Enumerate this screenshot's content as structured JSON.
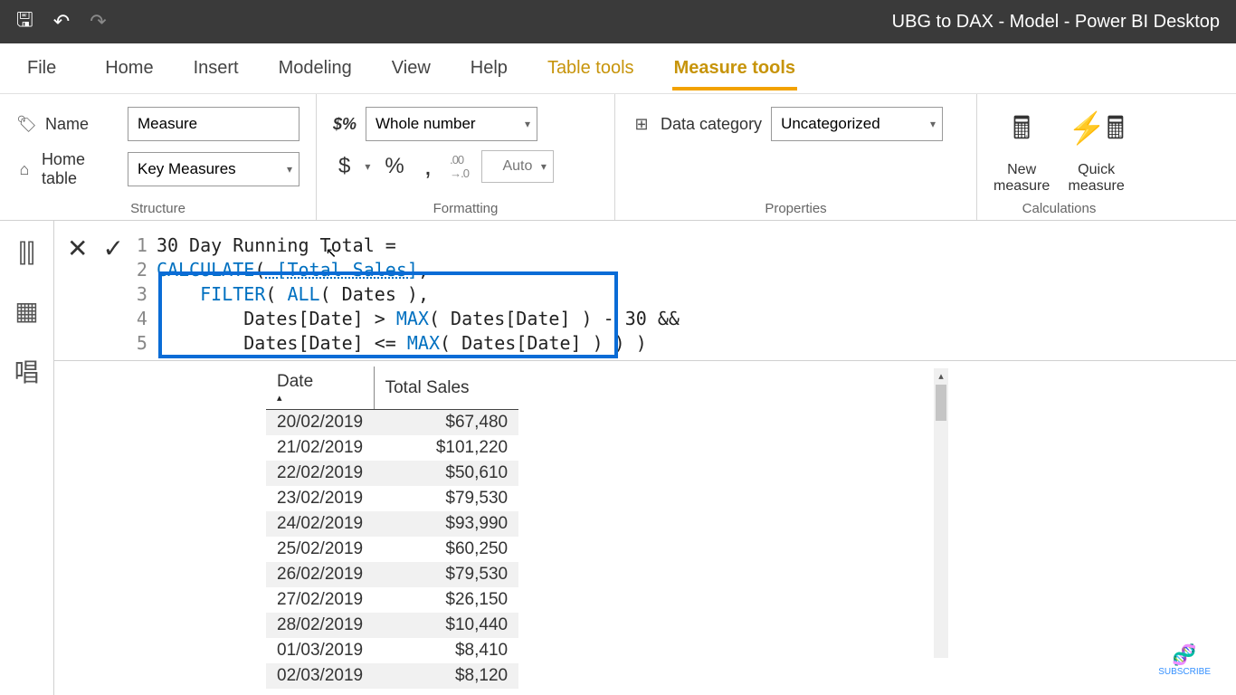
{
  "title": "UBG to DAX - Model - Power BI Desktop",
  "tabs": {
    "file": "File",
    "home": "Home",
    "insert": "Insert",
    "modeling": "Modeling",
    "view": "View",
    "help": "Help",
    "table_tools": "Table tools",
    "measure_tools": "Measure tools"
  },
  "structure": {
    "name_label": "Name",
    "name_value": "Measure",
    "home_table_label": "Home table",
    "home_table_value": "Key Measures",
    "group_label": "Structure"
  },
  "formatting": {
    "format_value": "Whole number",
    "decimals_placeholder": "Auto",
    "currency_symbol": "$",
    "percent_symbol": "%",
    "thousand_symbol": ",",
    "decimal_icon": ".00→.0",
    "group_label": "Formatting"
  },
  "properties": {
    "category_label": "Data category",
    "category_value": "Uncategorized",
    "group_label": "Properties"
  },
  "calculations": {
    "new_measure": "New measure",
    "quick_measure": "Quick measure",
    "group_label": "Calculations"
  },
  "code": {
    "line1_plain": "30 Day Running Total = ",
    "line2_fn": "CALCULATE",
    "line2_paren": "(",
    "line2_arg": " [Total Sales]",
    "line2_end": ",",
    "line3_indent": "    ",
    "line3_fn": "FILTER",
    "line3_rest_a": "( ",
    "line3_fn2": "ALL",
    "line3_rest_b": "( Dates ),",
    "line4_indent": "        ",
    "line4_a": "Dates[Date] > ",
    "line4_fn": "MAX",
    "line4_b": "( Dates[Date] ) - 30 &&",
    "line5_indent": "        ",
    "line5_a": "Dates[Date] <= ",
    "line5_fn": "MAX",
    "line5_b": "( Dates[Date] ) ) )"
  },
  "table": {
    "col1": "Date",
    "col2": "Total Sales",
    "rows": [
      {
        "d": "20/02/2019",
        "v": "$67,480"
      },
      {
        "d": "21/02/2019",
        "v": "$101,220"
      },
      {
        "d": "22/02/2019",
        "v": "$50,610"
      },
      {
        "d": "23/02/2019",
        "v": "$79,530"
      },
      {
        "d": "24/02/2019",
        "v": "$93,990"
      },
      {
        "d": "25/02/2019",
        "v": "$60,250"
      },
      {
        "d": "26/02/2019",
        "v": "$79,530"
      },
      {
        "d": "27/02/2019",
        "v": "$26,150"
      },
      {
        "d": "28/02/2019",
        "v": "$10,440"
      },
      {
        "d": "01/03/2019",
        "v": "$8,410"
      },
      {
        "d": "02/03/2019",
        "v": "$8,120"
      }
    ]
  },
  "subscribe": "SUBSCRIBE"
}
